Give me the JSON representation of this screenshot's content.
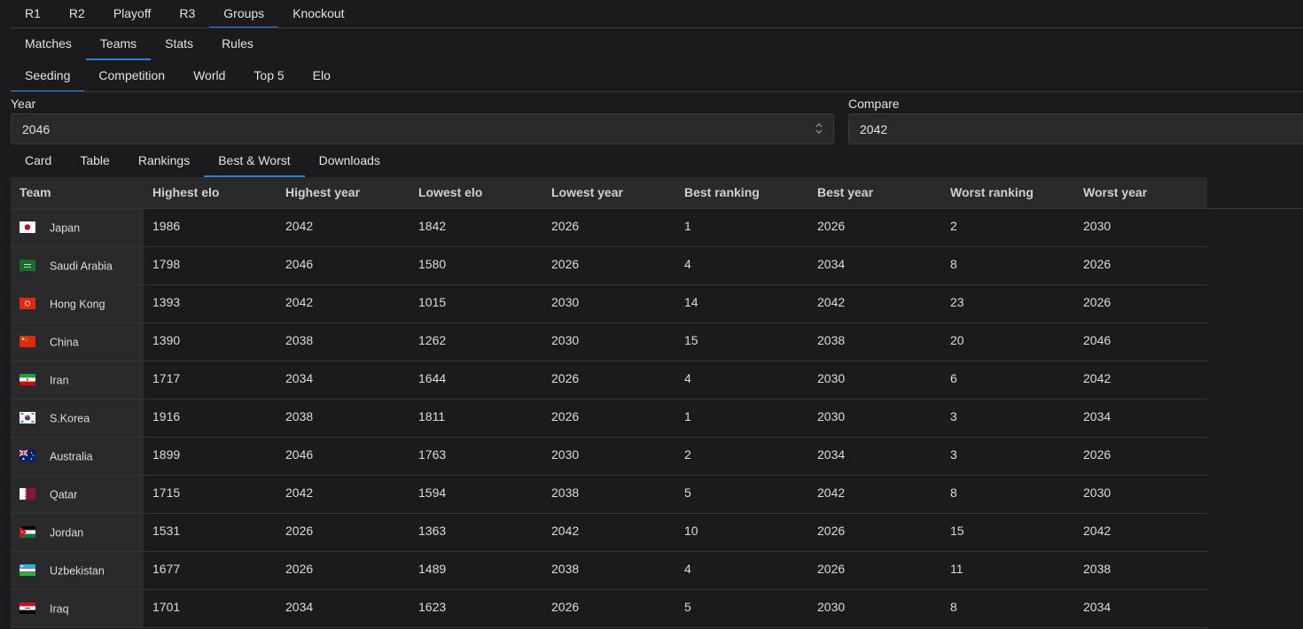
{
  "nav": {
    "level1": [
      "R1",
      "R2",
      "Playoff",
      "R3",
      "Groups",
      "Knockout"
    ],
    "level1_active": 4,
    "level2": [
      "Matches",
      "Teams",
      "Stats",
      "Rules"
    ],
    "level2_active": 1,
    "level3": [
      "Seeding",
      "Competition",
      "World",
      "Top 5",
      "Elo"
    ],
    "level3_active": 0,
    "level4": [
      "Card",
      "Table",
      "Rankings",
      "Best & Worst",
      "Downloads"
    ],
    "level4_active": 3
  },
  "controls": {
    "year_label": "Year",
    "year_value": "2046",
    "compare_label": "Compare",
    "compare_value": "2042"
  },
  "colors": {
    "accent": "#2d7fd6",
    "background": "#1b1b1d",
    "panel": "#2a2a2d"
  },
  "table": {
    "columns": [
      "Team",
      "Highest elo",
      "Highest year",
      "Lowest elo",
      "Lowest year",
      "Best ranking",
      "Best year",
      "Worst ranking",
      "Worst year"
    ],
    "rows": [
      {
        "team": "Japan",
        "flag": "japan-flag-icon",
        "cells": [
          "1986",
          "2042",
          "1842",
          "2026",
          "1",
          "2026",
          "2",
          "2030"
        ]
      },
      {
        "team": "Saudi Arabia",
        "flag": "saudi-arabia-flag-icon",
        "cells": [
          "1798",
          "2046",
          "1580",
          "2026",
          "4",
          "2034",
          "8",
          "2026"
        ]
      },
      {
        "team": "Hong Kong",
        "flag": "hong-kong-flag-icon",
        "cells": [
          "1393",
          "2042",
          "1015",
          "2030",
          "14",
          "2042",
          "23",
          "2026"
        ]
      },
      {
        "team": "China",
        "flag": "china-flag-icon",
        "cells": [
          "1390",
          "2038",
          "1262",
          "2030",
          "15",
          "2038",
          "20",
          "2046"
        ]
      },
      {
        "team": "Iran",
        "flag": "iran-flag-icon",
        "cells": [
          "1717",
          "2034",
          "1644",
          "2026",
          "4",
          "2030",
          "6",
          "2042"
        ]
      },
      {
        "team": "S.Korea",
        "flag": "south-korea-flag-icon",
        "cells": [
          "1916",
          "2038",
          "1811",
          "2026",
          "1",
          "2030",
          "3",
          "2034"
        ]
      },
      {
        "team": "Australia",
        "flag": "australia-flag-icon",
        "cells": [
          "1899",
          "2046",
          "1763",
          "2030",
          "2",
          "2034",
          "3",
          "2026"
        ]
      },
      {
        "team": "Qatar",
        "flag": "qatar-flag-icon",
        "cells": [
          "1715",
          "2042",
          "1594",
          "2038",
          "5",
          "2042",
          "8",
          "2030"
        ]
      },
      {
        "team": "Jordan",
        "flag": "jordan-flag-icon",
        "cells": [
          "1531",
          "2026",
          "1363",
          "2042",
          "10",
          "2026",
          "15",
          "2042"
        ]
      },
      {
        "team": "Uzbekistan",
        "flag": "uzbekistan-flag-icon",
        "cells": [
          "1677",
          "2026",
          "1489",
          "2038",
          "4",
          "2026",
          "11",
          "2038"
        ]
      },
      {
        "team": "Iraq",
        "flag": "iraq-flag-icon",
        "cells": [
          "1701",
          "2034",
          "1623",
          "2026",
          "5",
          "2030",
          "8",
          "2034"
        ]
      }
    ]
  }
}
